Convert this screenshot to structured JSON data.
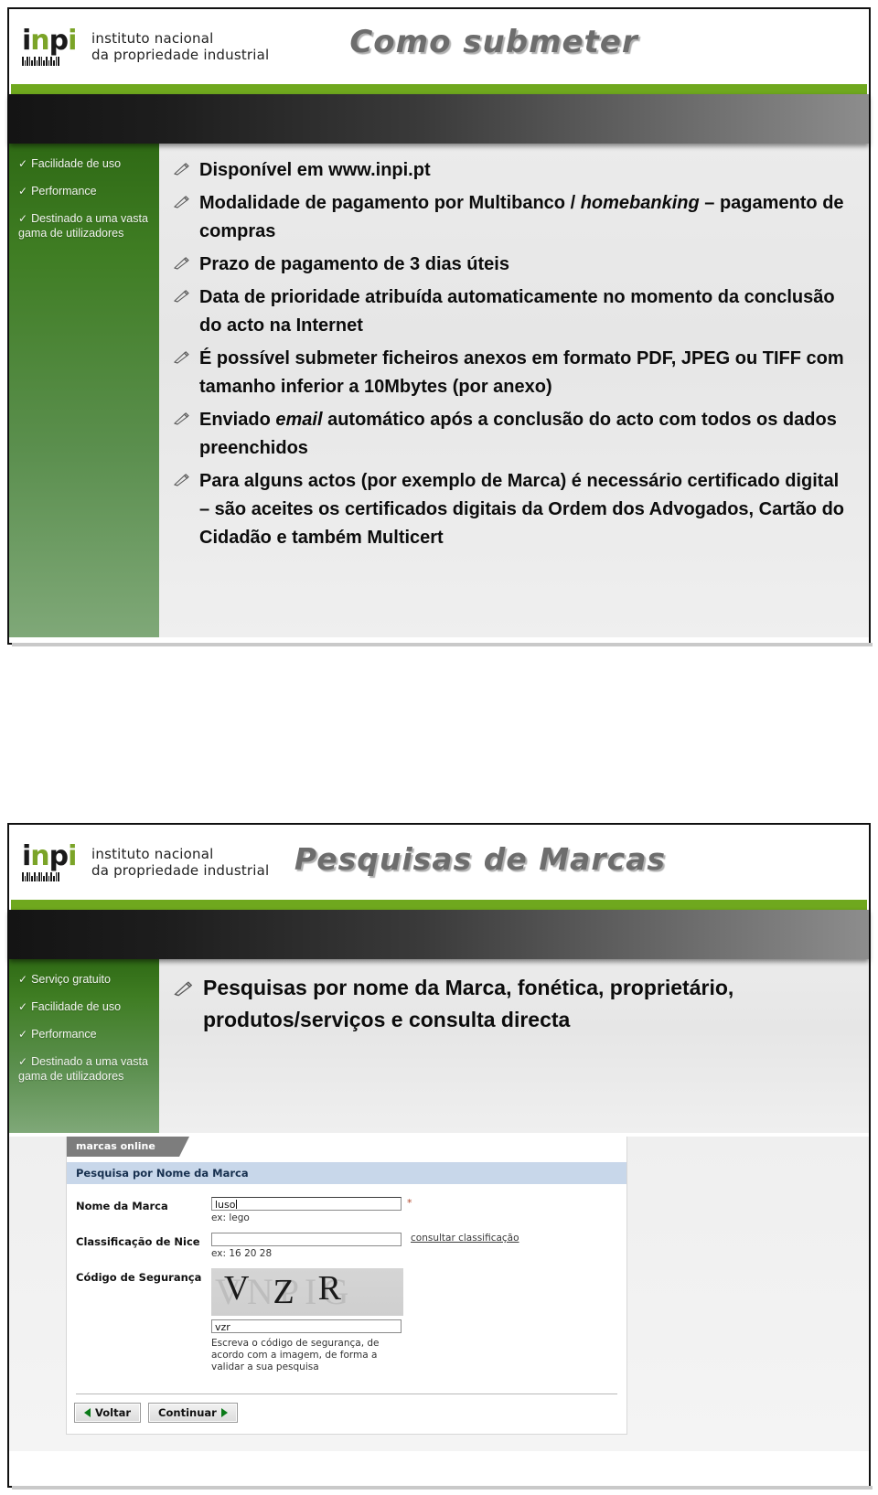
{
  "logo": {
    "brand": "inpi",
    "line1": "instituto nacional",
    "line2": "da propriedade industrial"
  },
  "colors": {
    "green_bar": "#6fa81e",
    "sidebar_green_top": "#2f6a15",
    "sidebar_green_bottom": "#7fa878",
    "title_gray": "#6d6d6d",
    "section_blue": "#c8d7ea",
    "required_red": "#b34a2e",
    "arrow_green": "#0a7a18"
  },
  "slide1": {
    "title": "Como  submeter",
    "sidebar": [
      "Facilidade de uso",
      "Performance",
      "Destinado a uma vasta gama de utilizadores"
    ],
    "bullets": [
      "Disponível em www.inpi.pt",
      "Modalidade de pagamento por Multibanco / homebanking – pagamento de compras",
      "Prazo de pagamento de 3 dias úteis",
      "Data de prioridade atribuída automaticamente no momento da conclusão do acto na Internet",
      "É possível submeter ficheiros anexos em formato PDF, JPEG ou TIFF com tamanho inferior a 10Mbytes (por anexo)",
      "Enviado email automático após a conclusão do acto com todos os dados preenchidos",
      "Para alguns actos (por exemplo de Marca) é necessário certificado digital – são aceites os certificados digitais da Ordem dos Advogados, Cartão do Cidadão e também Multicert"
    ]
  },
  "slide2": {
    "title": "Pesquisas de Marcas",
    "sidebar": [
      "Serviço gratuito",
      "Facilidade de uso",
      "Performance",
      "Destinado a uma vasta gama de utilizadores"
    ],
    "bullets": [
      "Pesquisas por nome da Marca, fonética, proprietário, produtos/serviços e consulta directa"
    ],
    "screenshot": {
      "tab_label": "marcas online",
      "section_title": "Pesquisa por Nome da Marca",
      "fields": [
        {
          "label": "Nome da Marca",
          "value": "luso",
          "hint": "ex: lego",
          "required_mark": "*"
        },
        {
          "label": "Classificação de Nice",
          "value": "",
          "hint": "ex: 16 20 28",
          "link": "consultar classificação"
        },
        {
          "label": "Código de Segurança",
          "captcha_text": "VZR",
          "captcha_ghost": "VNPIG",
          "value": "vzr",
          "note": "Escreva o código de segurança, de acordo com a imagem, de forma a validar a sua pesquisa"
        }
      ],
      "buttons": [
        {
          "label": "Voltar",
          "arrow": "left"
        },
        {
          "label": "Continuar",
          "arrow": "right"
        }
      ]
    }
  }
}
